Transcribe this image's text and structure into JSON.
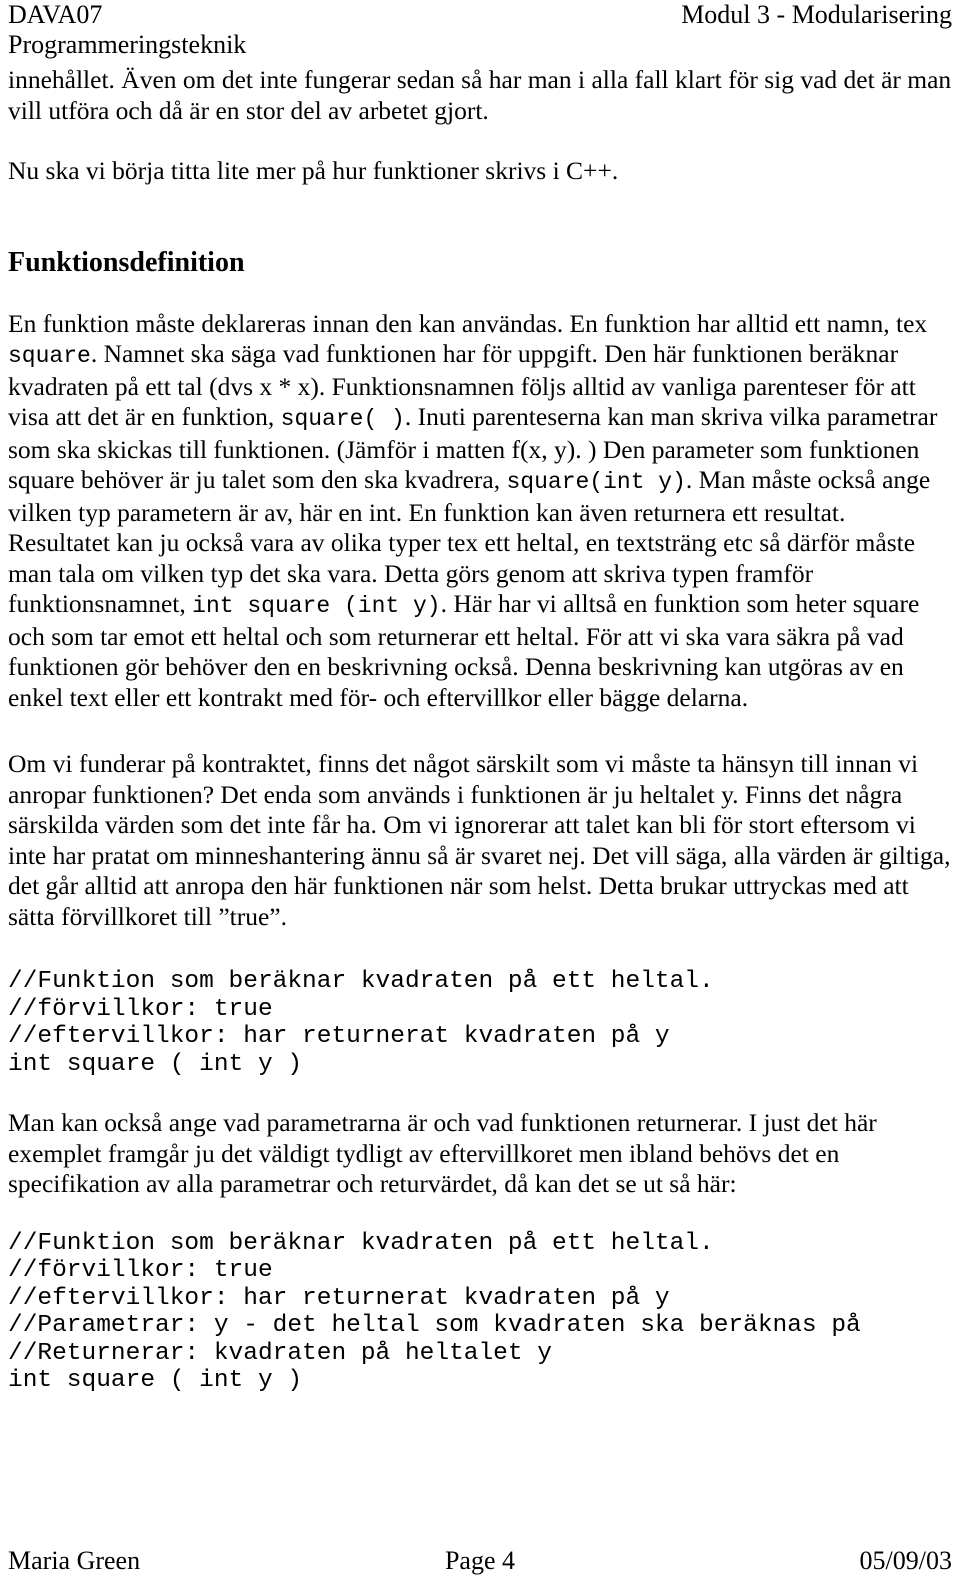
{
  "header": {
    "course_code": "DAVA07",
    "course_name": "Programmeringsteknik",
    "module": "Modul 3 - Modularisering"
  },
  "body": {
    "paragraph_intro": "innehållet. Även om det inte fungerar sedan så har man i alla fall klart för sig vad det är man vill utföra och då är en stor del av arbetet gjort.",
    "paragraph_cpp": "Nu ska vi börja titta lite mer på hur funktioner skrivs i C++.",
    "heading_funktionsdefinition": "Funktionsdefinition",
    "paragraph_def_1": "En funktion måste deklareras innan den kan användas. En funktion har alltid ett namn, tex ",
    "code_square": "square",
    "paragraph_def_2": ". Namnet ska säga vad funktionen har för uppgift. Den här funktionen beräknar kvadraten på ett tal (dvs x * x). Funktionsnamnen följs alltid av vanliga parenteser för att visa att det är en funktion, ",
    "code_square_parens": "square( )",
    "paragraph_def_3": ". Inuti parenteserna kan man skriva vilka parametrar som ska skickas till funktionen. (Jämför i matten f(x, y). ) Den parameter som funktionen square behöver är ju talet som den ska kvadrera, ",
    "code_square_int_y": "square(int y)",
    "paragraph_def_4": ". Man måste också ange vilken typ parametern är av, här en int. En funktion kan även returnera ett resultat. Resultatet kan ju också vara av olika typer tex ett heltal, en textsträng etc så därför måste man tala om vilken typ det ska vara. Detta görs genom att skriva typen framför funktionsnamnet, ",
    "code_int_square_int_y": "int square (int y)",
    "paragraph_def_5": ". Här har vi alltså en funktion som heter square och som tar emot ett heltal och som returnerar ett heltal. För att vi ska vara säkra på vad funktionen gör behöver den en beskrivning också. Denna beskrivning kan utgöras av en enkel text eller ett kontrakt med för- och eftervillkor eller bägge delarna.",
    "paragraph_contract": "Om vi funderar på kontraktet, finns det något särskilt som vi måste ta hänsyn till innan vi anropar funktionen? Det enda som används i funktionen är ju heltalet y. Finns det några särskilda värden som det inte får ha. Om vi ignorerar att talet kan bli för stort eftersom vi inte har pratat om minneshantering ännu så är svaret nej. Det vill säga, alla värden är giltiga, det går alltid att anropa den här funktionen när som helst. Detta brukar uttryckas med att sätta förvillkoret till ”true”.",
    "code_block_1": "//Funktion som beräknar kvadraten på ett heltal.\n//förvillkor: true\n//eftervillkor: har returnerat kvadraten på y\nint square ( int y )",
    "paragraph_params": "Man kan också ange vad parametrarna är och vad funktionen returnerar. I just det här exemplet framgår ju det väldigt tydligt av eftervillkoret men ibland behövs det en specifikation av alla parametrar och returvärdet, då kan det se ut så här:",
    "code_block_2": "//Funktion som beräknar kvadraten på ett heltal.\n//förvillkor: true\n//eftervillkor: har returnerat kvadraten på y\n//Parametrar: y - det heltal som kvadraten ska beräknas på\n//Returnerar: kvadraten på heltalet y\nint square ( int y )"
  },
  "footer": {
    "author": "Maria Green",
    "page": "Page 4",
    "date": "05/09/03"
  }
}
